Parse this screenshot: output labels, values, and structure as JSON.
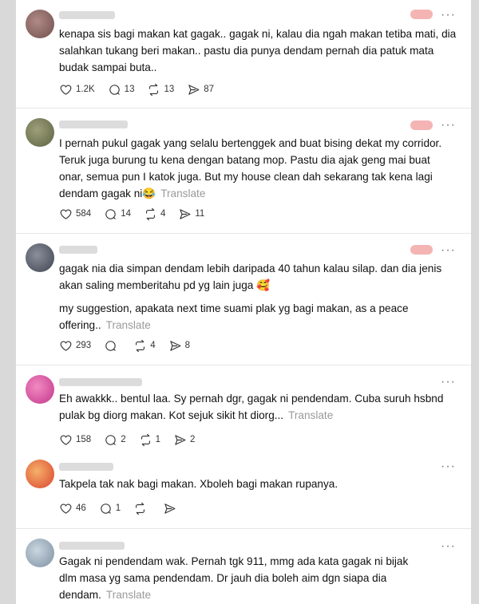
{
  "icons": {
    "like": "heart-icon",
    "reply": "comment-icon",
    "repost": "repost-icon",
    "share": "send-icon",
    "more": "more-options-icon"
  },
  "colors": {
    "text": "#111111",
    "muted": "#9a9a9a"
  },
  "more_glyph": "···",
  "posts": [
    {
      "lines": [
        "kenapa sis bagi makan kat gagak.. gagak ni, kalau dia ngah makan tetiba mati, dia",
        "salahkan tukang beri makan.. pastu dia punya dendam pernah dia patuk mata",
        "budak sampai buta.."
      ],
      "translate": "",
      "likes": "1.2K",
      "replies": "13",
      "reposts": "13",
      "shares": "87"
    },
    {
      "lines": [
        "I pernah pukul gagak yang selalu bertenggek and buat bising dekat my corridor.",
        "Teruk juga burung tu kena dengan batang mop. Pastu dia ajak geng mai buat",
        "onar, semua pun I katok juga. But my house clean dah sekarang tak kena lagi",
        "dendam gagak ni😂"
      ],
      "translate": "Translate",
      "likes": "584",
      "replies": "14",
      "reposts": "4",
      "shares": "11"
    },
    {
      "lines": [
        "gagak nia dia simpan dendam lebih daripada 40 tahun kalau silap. dan dia jenis",
        "akan saling memberitahu pd yg lain juga 🥰"
      ],
      "para2": [
        "my suggestion, apakata next time suami plak yg bagi makan, as a peace",
        "offering.."
      ],
      "translate": "Translate",
      "likes": "293",
      "replies": "",
      "reposts": "4",
      "shares": "8"
    },
    {
      "lines": [
        "Eh awakkk.. bentul laa. Sy pernah dgr, gagak ni pendendam. Cuba suruh hsbnd",
        "pulak bg diorg makan. Kot sejuk sikit ht diorg..."
      ],
      "translate": "Translate",
      "likes": "158",
      "replies": "2",
      "reposts": "1",
      "shares": "2"
    },
    {
      "lines": [
        "Takpela tak nak bagi makan. Xboleh bagi makan rupanya."
      ],
      "translate": "",
      "likes": "46",
      "replies": "1",
      "reposts": "",
      "shares": ""
    },
    {
      "lines": [
        "Gagak ni pendendam wak. Pernah tgk 911, mmg ada kata gagak ni bijak",
        "dlm masa yg sama pendendam. Dr jauh dia boleh aim dgn siapa dia",
        "dendam."
      ],
      "translate": "Translate",
      "likes": "",
      "replies": "",
      "reposts": "",
      "shares": ""
    }
  ]
}
